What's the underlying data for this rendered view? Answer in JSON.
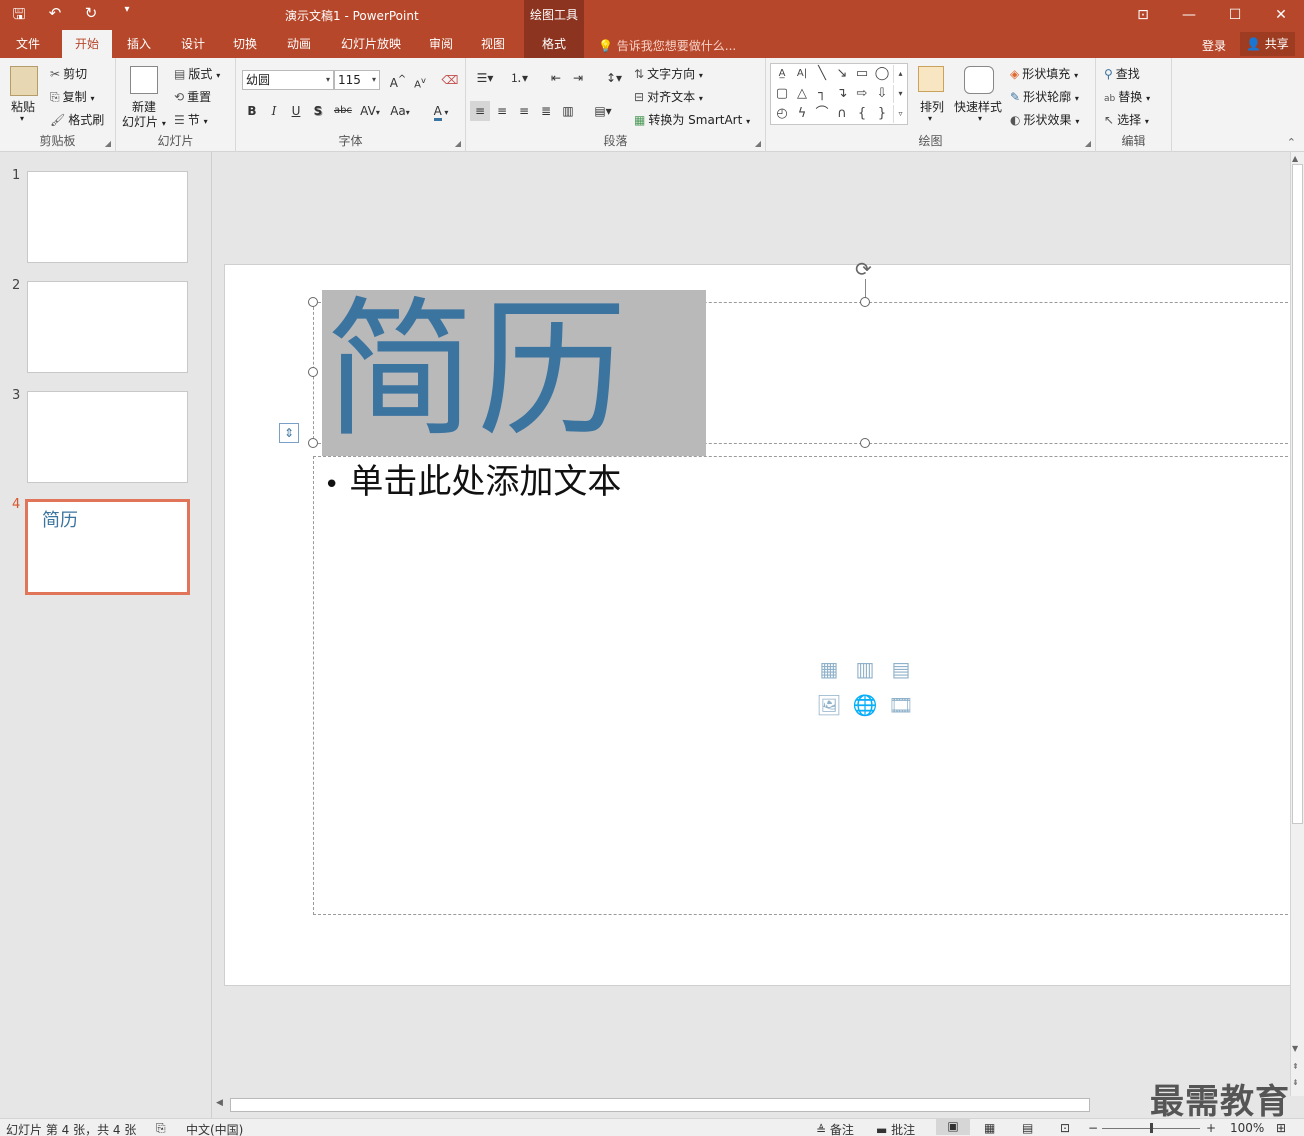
{
  "titlebar": {
    "title": "演示文稿1 - PowerPoint",
    "contextual_group": "绘图工具",
    "qat_icons": [
      "save-icon",
      "undo-icon",
      "redo-icon",
      "customize-qat-icon"
    ],
    "window_controls": [
      "ribbon-display-icon",
      "minimize-icon",
      "maximize-icon",
      "close-icon"
    ]
  },
  "tabs": {
    "file": "文件",
    "home": "开始",
    "insert": "插入",
    "design": "设计",
    "transitions": "切换",
    "animations": "动画",
    "slideshow": "幻灯片放映",
    "review": "审阅",
    "view": "视图",
    "format": "格式",
    "tell_me": "告诉我您想要做什么...",
    "login": "登录",
    "share": "共享"
  },
  "ribbon": {
    "clipboard": {
      "label": "剪贴板",
      "paste": "粘贴",
      "cut": "剪切",
      "copy": "复制",
      "format_painter": "格式刷"
    },
    "slides": {
      "label": "幻灯片",
      "new_slide_1": "新建",
      "new_slide_2": "幻灯片",
      "layout": "版式",
      "reset": "重置",
      "section": "节"
    },
    "font": {
      "label": "字体",
      "font_name": "幼圆",
      "font_size": "115",
      "bold": "B",
      "italic": "I",
      "underline": "U",
      "shadow": "S",
      "strike": "abc",
      "spacing": "AV",
      "case": "Aa",
      "color": "A",
      "grow": "A",
      "shrink": "A"
    },
    "paragraph": {
      "label": "段落",
      "text_direction": "文字方向",
      "align_text": "对齐文本",
      "convert_smartart": "转换为 SmartArt"
    },
    "drawing": {
      "label": "绘图",
      "arrange": "排列",
      "quick_styles": "快速样式",
      "shape_fill": "形状填充",
      "shape_outline": "形状轮廓",
      "shape_effects": "形状效果"
    },
    "editing": {
      "label": "编辑",
      "find": "查找",
      "replace": "替换",
      "select": "选择"
    }
  },
  "thumbnails": [
    {
      "num": "1",
      "title": ""
    },
    {
      "num": "2",
      "title": ""
    },
    {
      "num": "3",
      "title": ""
    },
    {
      "num": "4",
      "title": "简历"
    }
  ],
  "slide": {
    "title": "简历",
    "body_placeholder": "单击此处添加文本"
  },
  "status": {
    "slide_info": "幻灯片 第 4 张，共 4 张",
    "language": "中文(中国)",
    "notes": "备注",
    "comments": "批注",
    "zoom": "100%"
  },
  "watermark": "最需教育",
  "colors": {
    "accent": "#b7472a",
    "title_text": "#3c74a0",
    "selected_thumb_border": "#e1755a"
  }
}
